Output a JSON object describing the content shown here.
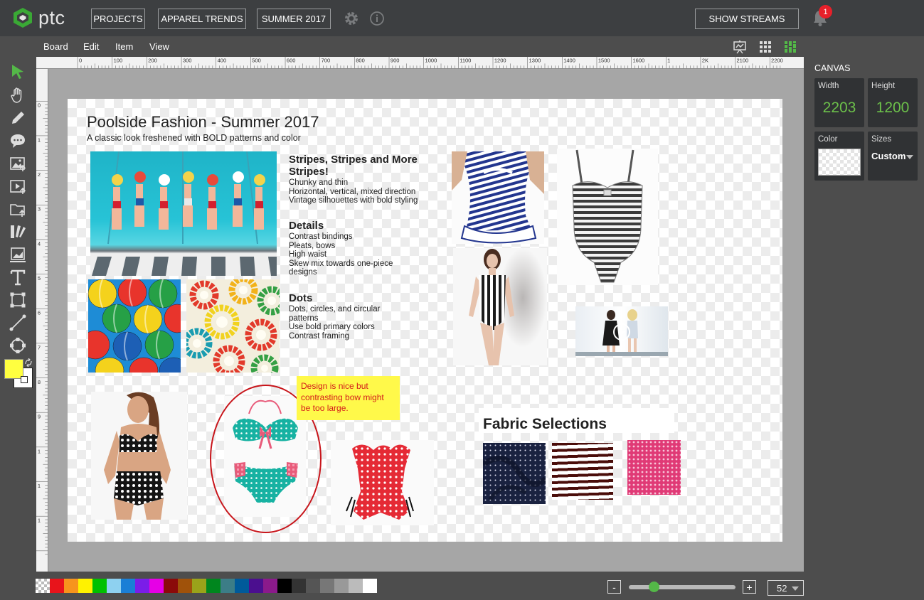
{
  "app": {
    "logo_text": "ptc"
  },
  "header": {
    "breadcrumbs": [
      "PROJECTS",
      "APPAREL TRENDS",
      "SUMMER 2017"
    ],
    "show_streams_label": "SHOW STREAMS",
    "notification_count": "1"
  },
  "menu": {
    "items": [
      "Board",
      "Edit",
      "Item",
      "View"
    ]
  },
  "ruler": {
    "marks": [
      "0",
      "100",
      "200",
      "300",
      "400",
      "500",
      "600",
      "700",
      "800",
      "900",
      "1000",
      "1100",
      "1200",
      "1300",
      "1400",
      "1500",
      "1600",
      "1",
      "2K",
      "2100",
      "2200"
    ]
  },
  "ruler_left": {
    "marks": [
      "0",
      "1",
      "2",
      "3",
      "4",
      "5",
      "6",
      "7",
      "8",
      "9",
      "1",
      "1",
      "1"
    ]
  },
  "board": {
    "title": "Poolside Fashion - Summer 2017",
    "subtitle": "A classic look freshened with BOLD patterns and color",
    "sections": [
      {
        "heading": "Stripes, Stripes and More Stripes!",
        "lines": [
          "Chunky and thin",
          "Horizontal, vertical, mixed direction",
          "Vintage silhouettes with bold styling"
        ]
      },
      {
        "heading": "Details",
        "lines": [
          "Contrast bindings",
          "Pleats, bows",
          "High waist",
          "Skew mix towards one-piece designs"
        ]
      },
      {
        "heading": "Dots",
        "lines": [
          "Dots, circles, and circular patterns",
          "Use bold primary colors",
          "Contrast framing"
        ]
      }
    ],
    "note": "Design is nice but contrasting bow might be too large.",
    "fabric_title": "Fabric Selections"
  },
  "canvas_panel": {
    "title": "CANVAS",
    "width_label": "Width",
    "width_value": "2203",
    "height_label": "Height",
    "height_value": "1200",
    "color_label": "Color",
    "sizes_label": "Sizes",
    "sizes_value": "Custom"
  },
  "palette": [
    "transparent",
    "#e8141b",
    "#f7941d",
    "#fff200",
    "#00c000",
    "#8ed1f0",
    "#1a7fd6",
    "#7b1de8",
    "#e600e6",
    "#8b0a0a",
    "#a0520a",
    "#9aa31a",
    "#00861e",
    "#3c7d87",
    "#005a9a",
    "#4b0f8f",
    "#8b1a8b",
    "#000000",
    "#333333",
    "#555555",
    "#777777",
    "#999999",
    "#bbbbbb",
    "#ffffff"
  ],
  "zoom": {
    "minus_label": "-",
    "plus_label": "+",
    "value": "52"
  },
  "colors": {
    "accent_green": "#54b848",
    "topbar": "#3d3f41",
    "panel": "#4d4d4d",
    "note_yellow": "#fff94a",
    "foreground_swatch": "#ffff40"
  }
}
